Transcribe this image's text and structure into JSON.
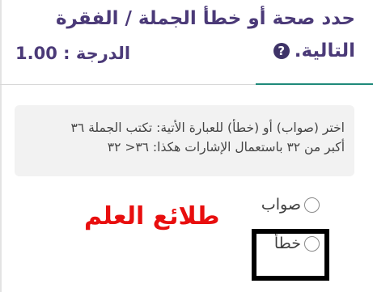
{
  "header": {
    "title_line1": "حدد صحة أو خطأ الجملة / الفقرة",
    "title_line2": "التالية.",
    "help_icon": "question-circle-icon",
    "grade_label": "الدرجة : 1.00"
  },
  "question": {
    "line1": "اختر (صواب) أو (خطأ) للعبارة الأتية: تكتب الجملة ٣٦",
    "line2": "أكبر من ٣٢ باستعمال الإشارات هكذا: ٣٦< ٣٢"
  },
  "options": {
    "true_label": "صواب",
    "false_label": "خطأ"
  },
  "watermark": {
    "text": "طلائع العلم",
    "color": "#e80e0e"
  },
  "colors": {
    "title": "#4b3a78",
    "accent": "#1f8a7a",
    "question_bg": "#f2f2f2"
  }
}
